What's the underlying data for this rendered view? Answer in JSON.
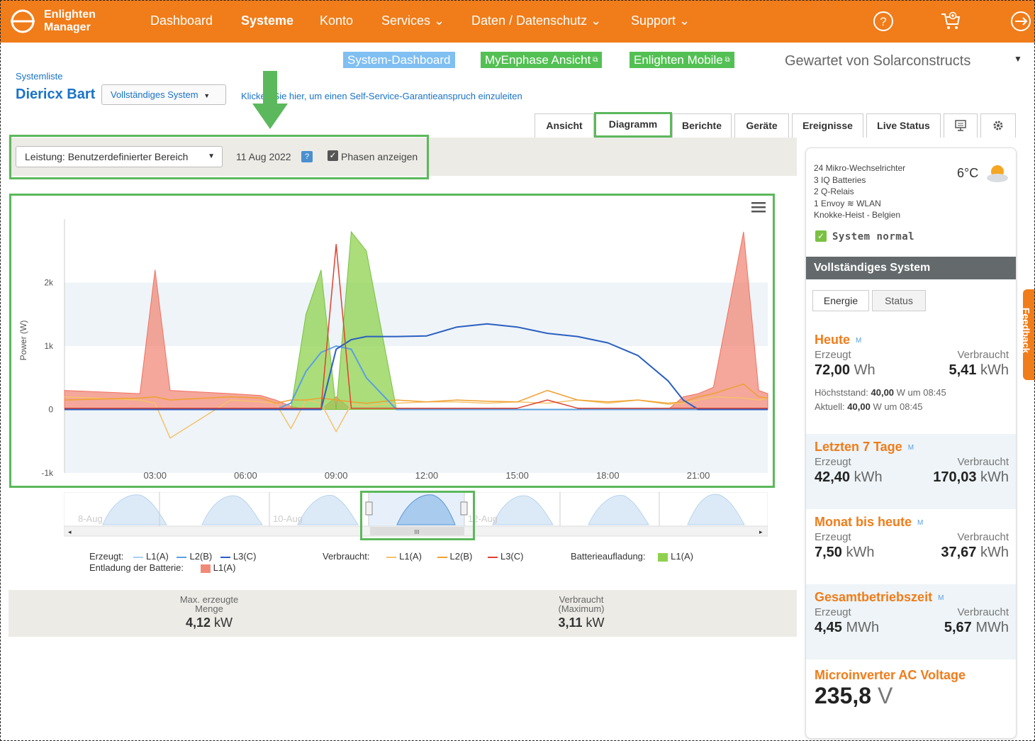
{
  "nav": {
    "logo_line1": "Enlighten",
    "logo_line2": "Manager",
    "items": [
      "Dashboard",
      "Systeme",
      "Konto",
      "Services ⌄",
      "Daten / Datenschutz ⌄",
      "Support ⌄"
    ],
    "icons": [
      "help-icon",
      "cart-icon",
      "logout-icon"
    ]
  },
  "links": {
    "system_dashboard": "System-Dashboard",
    "myenphase": "MyEnphase Ansicht",
    "enlighten_mobile": "Enlighten Mobile",
    "maintained_by": "Gewartet von Solarconstructs"
  },
  "system": {
    "breadcrumb": "Systemliste",
    "name": "Diericx Bart",
    "dropdown": "Vollständiges System",
    "warranty_link": "Klicken Sie hier, um einen Self-Service-Garantieanspruch einzuleiten"
  },
  "tabs": [
    "Ansicht",
    "Diagramm",
    "Berichte",
    "Geräte",
    "Ereignisse",
    "Live Status"
  ],
  "controls": {
    "range_select": "Leistung: Benutzerdefinierter Bereich",
    "date": "11 Aug 2022",
    "help": "?",
    "phases_label": "Phasen anzeigen"
  },
  "colors": {
    "brand_orange": "#f07c1a",
    "highlight_green": "#5cb85c",
    "battery_charge": "#8fd14f",
    "battery_discharge": "#f08a78",
    "prod_l3": "#2b5fc0",
    "prod_l2": "#5aa0e0",
    "cons_l1": "#f5c26b",
    "cons_l2": "#f0a030",
    "cons_l3": "#e04030"
  },
  "chart_data": {
    "type": "area",
    "ylabel": "Power (W)",
    "y_ticks": [
      "-1k",
      "0",
      "1k",
      "2k"
    ],
    "x_ticks": [
      "03:00",
      "06:00",
      "09:00",
      "12:00",
      "15:00",
      "18:00",
      "21:00"
    ],
    "ylim": [
      -1000,
      3000
    ],
    "x_hours": [
      0,
      2.5,
      3.0,
      3.5,
      5.5,
      6.5,
      7.0,
      7.5,
      8.0,
      8.5,
      9.0,
      9.5,
      10.0,
      11.0,
      12.0,
      13.0,
      14.0,
      15.0,
      16.0,
      17.0,
      18.0,
      19.0,
      20.0,
      20.5,
      21.0,
      21.5,
      22.5,
      23.0,
      23.3
    ],
    "series": [
      {
        "name": "Erzeugt L3(C)",
        "values": [
          0,
          0,
          0,
          0,
          0,
          0,
          0,
          0,
          0,
          0,
          950,
          1100,
          1150,
          1150,
          1160,
          1300,
          1350,
          1300,
          1200,
          1150,
          1050,
          850,
          450,
          150,
          0,
          0,
          0,
          0,
          0
        ]
      },
      {
        "name": "Erzeugt L2(B)",
        "values": [
          0,
          0,
          0,
          0,
          0,
          0,
          0,
          100,
          600,
          900,
          1000,
          950,
          500,
          0,
          0,
          0,
          0,
          0,
          0,
          0,
          0,
          0,
          0,
          0,
          0,
          0,
          0,
          0,
          0
        ]
      },
      {
        "name": "Batterieaufladung L1(A)",
        "values": [
          0,
          0,
          0,
          0,
          0,
          0,
          0,
          0,
          1500,
          2200,
          0,
          2800,
          2500,
          0,
          0,
          0,
          0,
          0,
          0,
          0,
          0,
          0,
          0,
          0,
          0,
          0,
          0,
          0,
          0
        ]
      },
      {
        "name": "Entladung der Batterie L1(A)",
        "values": [
          300,
          250,
          2200,
          300,
          250,
          220,
          150,
          50,
          0,
          0,
          200,
          0,
          0,
          0,
          0,
          0,
          0,
          0,
          0,
          0,
          0,
          0,
          0,
          200,
          250,
          350,
          2800,
          300,
          250
        ]
      },
      {
        "name": "Verbraucht L1(A)",
        "values": [
          200,
          150,
          100,
          -450,
          150,
          120,
          100,
          -300,
          150,
          100,
          -350,
          80,
          60,
          100,
          120,
          120,
          100,
          120,
          100,
          150,
          100,
          150,
          80,
          100,
          150,
          200,
          180,
          150,
          180
        ]
      },
      {
        "name": "Verbraucht L2(B)",
        "values": [
          150,
          180,
          200,
          150,
          200,
          180,
          100,
          150,
          150,
          180,
          150,
          120,
          100,
          150,
          120,
          150,
          130,
          120,
          300,
          150,
          120,
          150,
          100,
          120,
          200,
          250,
          400,
          200,
          180
        ]
      },
      {
        "name": "Verbraucht L3(C)",
        "values": [
          20,
          20,
          20,
          20,
          20,
          20,
          20,
          20,
          20,
          20,
          2600,
          20,
          20,
          20,
          20,
          20,
          20,
          20,
          150,
          20,
          20,
          20,
          20,
          20,
          20,
          20,
          20,
          20,
          20
        ]
      }
    ],
    "bands": [
      [
        1000,
        2000
      ],
      [
        -1000,
        0
      ]
    ]
  },
  "navigator": {
    "labels": [
      "8-Aug",
      "10-Aug",
      "12-Aug"
    ],
    "scroll_grip": "III"
  },
  "legend": {
    "produced": "Erzeugt:",
    "consumed": "Verbraucht:",
    "battery_charge": "Batterieaufladung:",
    "battery_discharge": "Entladung der Batterie:",
    "l1": "L1(A)",
    "l2": "L2(B)",
    "l3": "L3(C)"
  },
  "stats": {
    "max_produced_label1": "Max. erzeugte",
    "max_produced_label2": "Menge",
    "max_produced_value": "4,12",
    "max_produced_unit": "kW",
    "consumed_label1": "Verbraucht",
    "consumed_label2": "(Maximum)",
    "consumed_value": "3,11",
    "consumed_unit": "kW"
  },
  "side": {
    "info": [
      "24 Mikro-Wechselrichter",
      "3 IQ Batteries",
      "2 Q-Relais",
      "1 Envoy",
      "Knokke-Heist - Belgien"
    ],
    "wlan": "WLAN",
    "temperature": "6°C",
    "status": "System normal",
    "header": "Vollständiges System",
    "tabs": [
      "Energie",
      "Status"
    ],
    "m": "M",
    "produced_label": "Erzeugt",
    "consumed_label": "Verbraucht",
    "today": {
      "title": "Heute",
      "prod": "72,00",
      "prod_unit": "Wh",
      "cons": "5,41",
      "cons_unit": "kWh",
      "peak_label": "Höchststand:",
      "peak_val": "40,00",
      "peak_rest": "W um 08:45",
      "current_label": "Aktuell:",
      "current_val": "40,00",
      "current_rest": "W um 08:45"
    },
    "week": {
      "title": "Letzten 7 Tage",
      "prod": "42,40",
      "prod_unit": "kWh",
      "cons": "170,03",
      "cons_unit": "kWh"
    },
    "month": {
      "title": "Monat bis heute",
      "prod": "7,50",
      "prod_unit": "kWh",
      "cons": "37,67",
      "cons_unit": "kWh"
    },
    "lifetime": {
      "title": "Gesamtbetriebszeit",
      "prod": "4,45",
      "prod_unit": "MWh",
      "cons": "5,67",
      "cons_unit": "MWh"
    },
    "voltage": {
      "title": "Microinverter AC Voltage",
      "value": "235,8",
      "unit": "V"
    }
  },
  "feedback": "Feedback"
}
